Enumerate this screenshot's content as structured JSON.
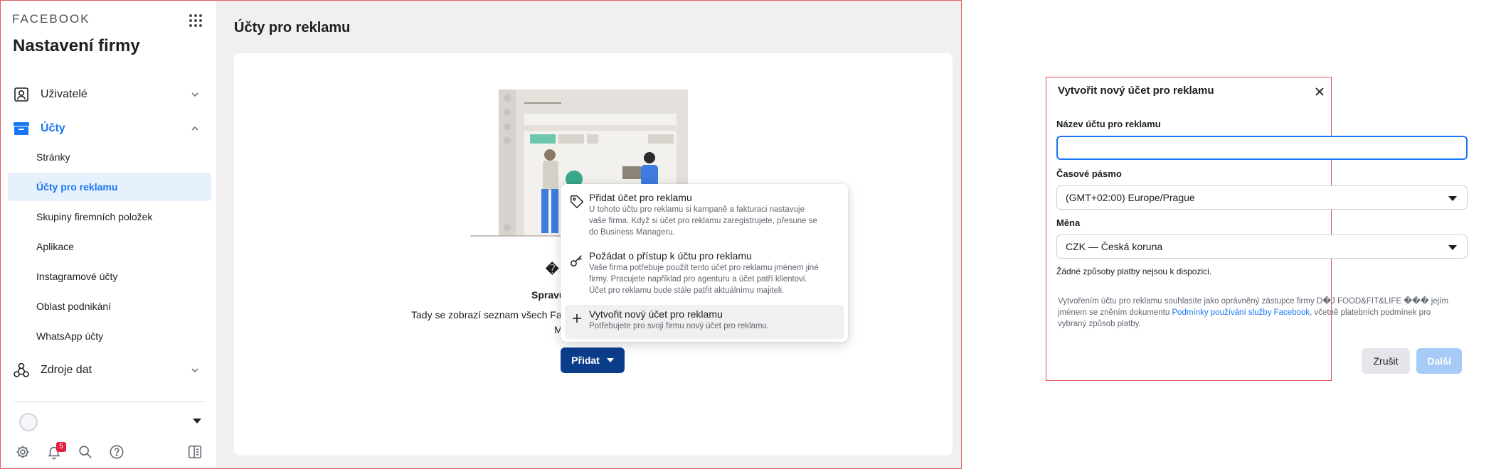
{
  "sidebar": {
    "brand": "FACEBOOK",
    "title": "Nastavení firmy",
    "nav": {
      "users": "Uživatelé",
      "accounts": "Účty",
      "data_sources": "Zdroje dat"
    },
    "sub_items": [
      "Stránky",
      "Účty pro reklamu",
      "Skupiny firemních položek",
      "Aplikace",
      "Instagramové účty",
      "Oblast podnikání",
      "WhatsApp účty"
    ],
    "notification_count": "5"
  },
  "main": {
    "title": "Účty pro reklamu",
    "empty_heading": "�",
    "empty_sub": "Spravu",
    "empty_desc": "Tady se zobrazí seznam všech Fa",
    "empty_desc2": "M",
    "add_button": "Přidat"
  },
  "menu": [
    {
      "title": "Přidat účet pro reklamu",
      "desc": [
        "U tohoto účtu pro reklamu si kampaně a fakturaci nastavuje",
        "vaše firma. Když si účet pro reklamu zaregistrujete, přesune se",
        "do Business Manageru."
      ],
      "icon": "tag-icon"
    },
    {
      "title": "Požádat o přístup k účtu pro reklamu",
      "desc": [
        "Vaše firma potřebuje použít tento účet pro reklamu jménem jiné",
        "firmy. Pracujete například pro agenturu a účet patří klientovi.",
        "Účet pro reklamu bude stále patřit aktuálnímu majiteli."
      ],
      "icon": "key-icon"
    },
    {
      "title": "Vytvořit nový účet pro reklamu",
      "desc": [
        "Potřebujete pro svoji firmu nový účet pro reklamu."
      ],
      "icon": "plus-icon"
    }
  ],
  "dialog": {
    "title": "Vytvořit nový účet pro reklamu",
    "name_label": "Název účtu pro reklamu",
    "name_value": "",
    "timezone_label": "Časové pásmo",
    "timezone_value": "(GMT+02:00) Europe/Prague",
    "currency_label": "Měna",
    "currency_value": "CZK — Česká koruna",
    "no_payment": "Žádné způsoby platby nejsou k dispozici.",
    "legal_before": "Vytvořením účtu pro reklamu souhlasíte jako oprávněný zástupce firmy D�J FOOD&FIT&LIFE ��� jejím jménem se zněním dokumentu ",
    "legal_link": "Podmínky používání služby Facebook",
    "legal_after": ", včetně platebních podmínek pro vybraný způsob platby.",
    "cancel": "Zrušit",
    "next": "Další"
  },
  "colors": {
    "accent": "#1877f2",
    "primary_button": "#0a3d8a",
    "frame_border": "#e06060",
    "disabled_button": "#a6cbf6"
  }
}
